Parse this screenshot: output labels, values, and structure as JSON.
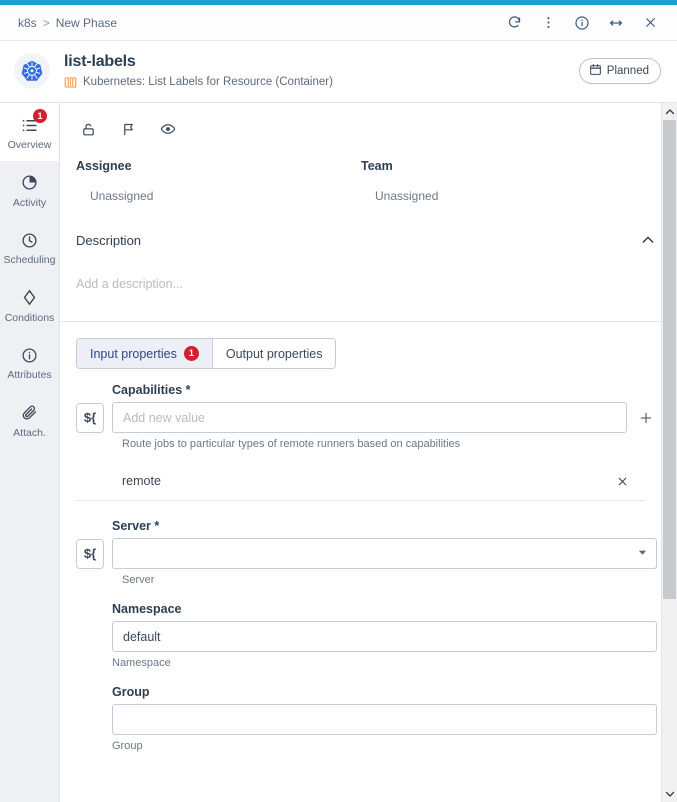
{
  "window": {
    "breadcrumb_root": "k8s",
    "breadcrumb_sep": ">",
    "breadcrumb_current": "New Phase",
    "actions": [
      {
        "name": "refresh-icon",
        "label": "Refresh"
      },
      {
        "name": "more-vertical-icon",
        "label": "More options"
      },
      {
        "name": "info-icon",
        "label": "Info"
      },
      {
        "name": "resize-horizontal-icon",
        "label": "Resize"
      },
      {
        "name": "close-icon",
        "label": "Close"
      }
    ]
  },
  "header": {
    "logo": "kubernetes-logo",
    "title": "list-labels",
    "subtitle": "Kubernetes: List Labels for Resource (Container)",
    "subtitle_icon": "container-icon",
    "status_badge": {
      "icon": "calendar-icon",
      "label": "Planned"
    }
  },
  "sidebar": {
    "items": [
      {
        "label": "Overview",
        "icon": "list-icon",
        "badge": "1",
        "active": true
      },
      {
        "label": "Activity",
        "icon": "pie-chart-icon",
        "badge": "",
        "active": false
      },
      {
        "label": "Scheduling",
        "icon": "clock-icon",
        "badge": "",
        "active": false
      },
      {
        "label": "Conditions",
        "icon": "diamond-icon",
        "badge": "",
        "active": false
      },
      {
        "label": "Attributes",
        "icon": "info-circle-icon",
        "badge": "",
        "active": false
      },
      {
        "label": "Attach.",
        "icon": "paperclip-icon",
        "badge": "",
        "active": false
      }
    ]
  },
  "toolbar": {
    "buttons": [
      {
        "name": "unlock-icon",
        "label": "Lock"
      },
      {
        "name": "flag-icon",
        "label": "Flag"
      },
      {
        "name": "eye-icon",
        "label": "Watch"
      }
    ]
  },
  "meta": {
    "assignee_label": "Assignee",
    "assignee_value": "Unassigned",
    "team_label": "Team",
    "team_value": "Unassigned"
  },
  "description": {
    "title": "Description",
    "placeholder": "Add a description...",
    "collapse_icon": "chevron-up-icon"
  },
  "tabs": [
    {
      "label": "Input properties",
      "badge": "1",
      "active": true
    },
    {
      "label": "Output properties",
      "badge": "",
      "active": false
    }
  ],
  "form": {
    "capabilities": {
      "label": "Capabilities *",
      "var_button": "${",
      "placeholder": "Add new value",
      "value": "",
      "hint": "Route jobs to particular types of remote runners based on capabilities",
      "add_icon": "plus-icon",
      "values": [
        {
          "text": "remote",
          "remove_icon": "close-icon"
        }
      ]
    },
    "server": {
      "label": "Server *",
      "var_button": "${",
      "value": "",
      "placeholder": "",
      "hint": "Server",
      "caret_icon": "chevron-down-icon"
    },
    "namespace": {
      "label": "Namespace",
      "value": "default",
      "placeholder": "",
      "hint": "Namespace"
    },
    "group": {
      "label": "Group",
      "value": "",
      "placeholder": "",
      "hint": "Group"
    }
  },
  "scrollbar": {
    "up_icon": "chevron-up-icon",
    "down_icon": "chevron-down-icon"
  },
  "colors": {
    "accent": "#17a2d4",
    "badge": "#d32030",
    "k8s_blue": "#326ce5",
    "container_orange": "#f5a35c",
    "tab_active_bg": "#eceff6"
  }
}
